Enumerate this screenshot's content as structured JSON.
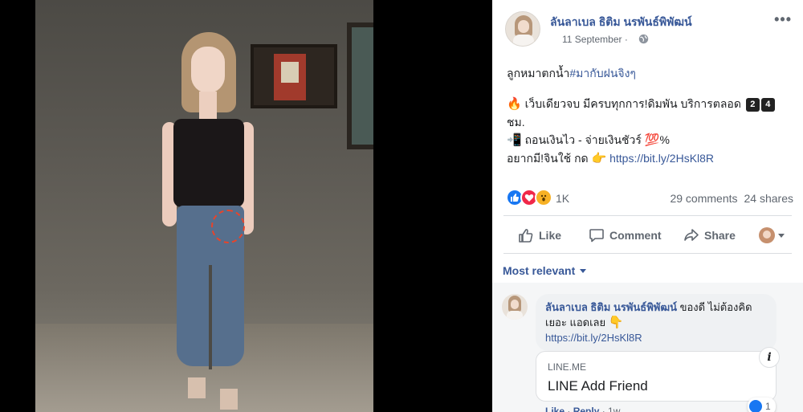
{
  "post": {
    "author": "ลันลาเบล ธิติม นรพันธ์พิพัฒน์",
    "date": "11 September",
    "date_sep": "·",
    "privacy_icon": "globe-icon",
    "more_label": "•••",
    "lines": {
      "line1_text": "ลูกหมาตกน้ำ",
      "line1_hashtag": "#มากับฝนจิงๆ",
      "line2_emoji": "🔥",
      "line2_text": "เว็บเดียวจบ มีครบทุกการ!ดิมพัน บริการตลอด",
      "line2_key1": "2",
      "line2_key2": "4",
      "line3_text": "ชม.",
      "line4_emoji": "📲",
      "line4_text": "ถอนเงินไว - จ่ายเงินชัวร์",
      "line4_emoji2": "💯",
      "line4_suffix": "%",
      "line5_text": "อยากมี!จินใช้ กด",
      "line5_emoji": "👉",
      "line5_link": "https://bit.ly/2HsKl8R"
    },
    "reactions": {
      "count": "1K",
      "types": [
        "like",
        "love",
        "wow"
      ]
    },
    "comments_count": "29 comments",
    "shares_count": "24 shares"
  },
  "actions": {
    "like": "Like",
    "comment": "Comment",
    "share": "Share"
  },
  "sort_label": "Most relevant",
  "comment": {
    "author": "ลันลาเบล ธิติม นรพันธ์พิพัฒน์",
    "text": " ของดี ไม่ต้องคิดเยอะ แอดเลย ",
    "emoji": "👇",
    "link": "https://bit.ly/2HsKl8R",
    "preview": {
      "domain": "LINE.ME",
      "title": "LINE Add Friend",
      "info_label": "i"
    },
    "meta": {
      "like": "Like",
      "sep1": " · ",
      "reply": "Reply",
      "sep2": " · ",
      "time": "1w"
    },
    "reaction_count": "1"
  },
  "colors": {
    "link": "#385898",
    "muted": "#606770",
    "like_blue": "#1877f2",
    "love_red": "#f02849",
    "wow_yellow": "#f7b125",
    "marker": "#e8442a"
  }
}
